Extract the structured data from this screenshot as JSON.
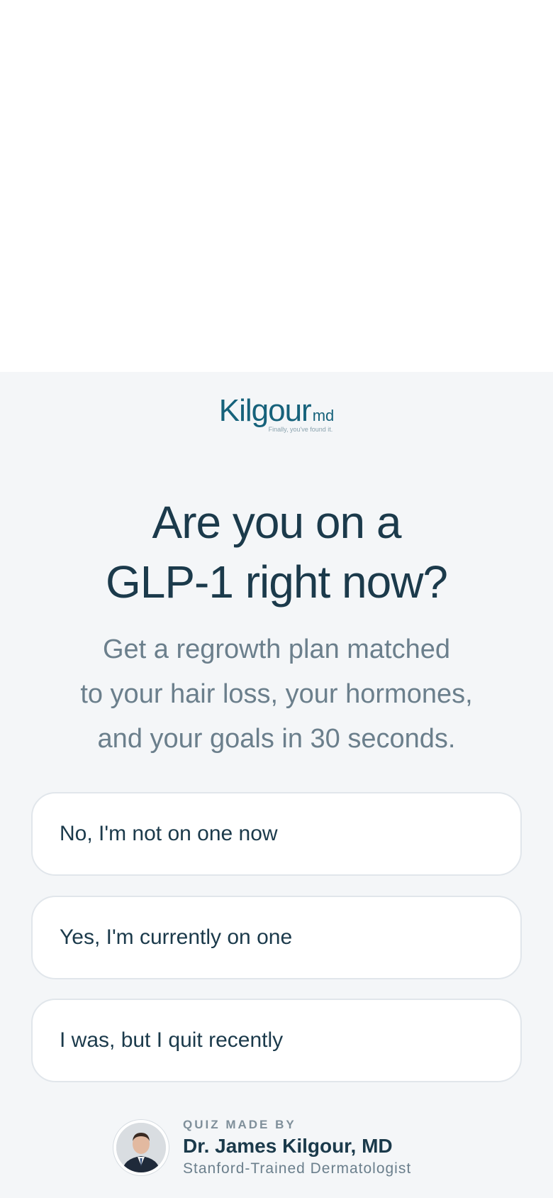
{
  "brand": {
    "name": "Kilgour",
    "suffix": "md",
    "tagline": "Finally, you've found it."
  },
  "headline": {
    "line1": "Are you on a",
    "line2": "GLP-1 right now?"
  },
  "subtext": {
    "line1": "Get a regrowth plan matched",
    "line2": "to your hair loss, your hormones,",
    "line3": "and your goals in 30 seconds."
  },
  "options": [
    {
      "label": "No, I'm not on one now"
    },
    {
      "label": "Yes, I'm currently on one"
    },
    {
      "label": "I was, but I quit recently"
    }
  ],
  "author": {
    "eyebrow": "QUIZ MADE BY",
    "name": "Dr. James Kilgour, MD",
    "title": "Stanford-Trained Dermatologist"
  },
  "colors": {
    "brand": "#16627b",
    "heading": "#1b3a4b",
    "muted": "#6b7f8c",
    "background": "#f4f6f8",
    "card": "#ffffff",
    "card_border": "#e1e6eb"
  }
}
